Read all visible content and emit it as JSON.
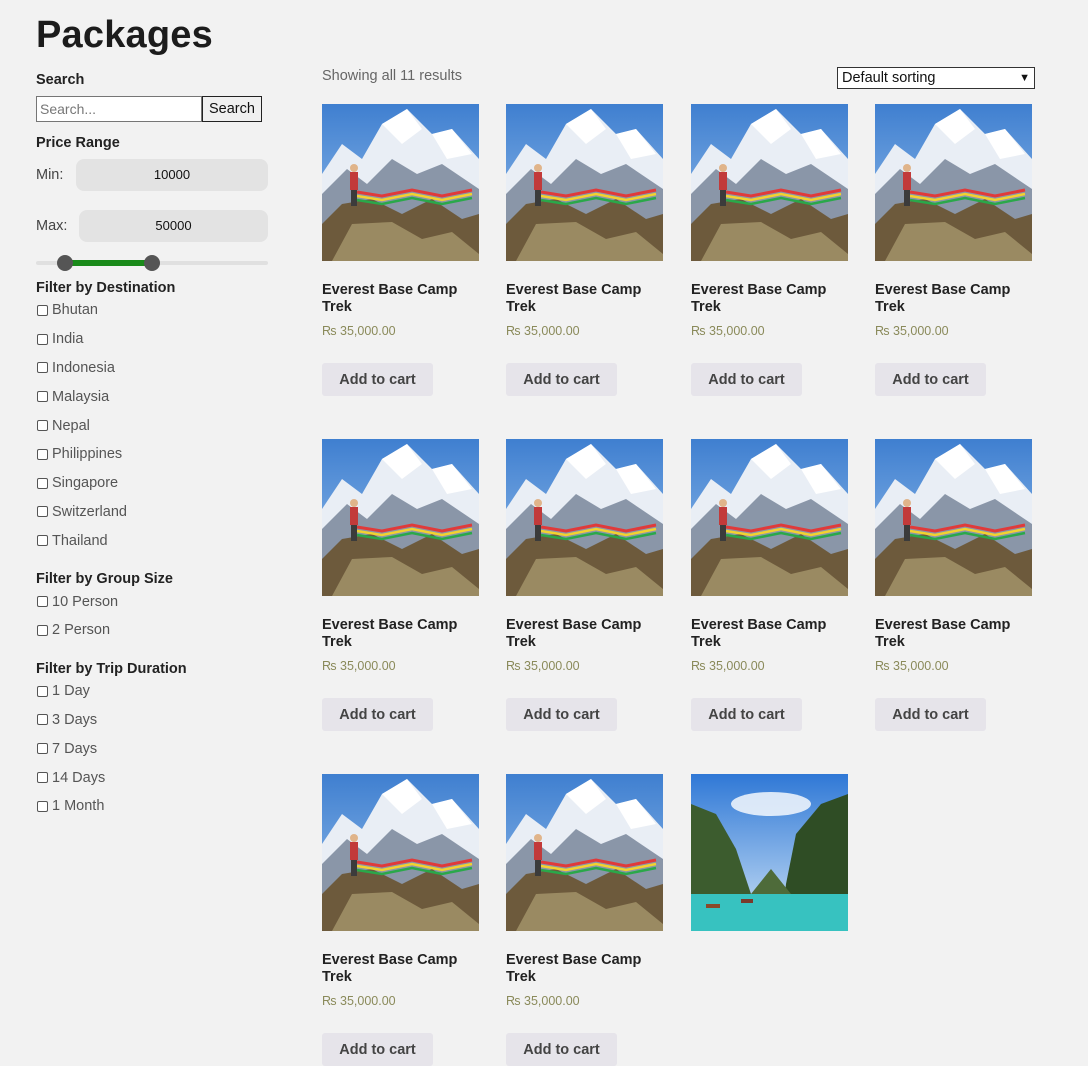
{
  "page": {
    "title": "Packages"
  },
  "sidebar": {
    "search": {
      "heading": "Search",
      "placeholder": "Search...",
      "button_label": "Search"
    },
    "price_range": {
      "heading": "Price Range",
      "min_label": "Min:",
      "min_value": "10000",
      "max_label": "Max:",
      "max_value": "50000",
      "slider_low_fraction": 0.12,
      "slider_high_fraction": 0.5
    },
    "destination": {
      "heading": "Filter by Destination",
      "options": [
        "Bhutan",
        "India",
        "Indonesia",
        "Malaysia",
        "Nepal",
        "Philippines",
        "Singapore",
        "Switzerland",
        "Thailand"
      ]
    },
    "group_size": {
      "heading": "Filter by Group Size",
      "options": [
        "10 Person",
        "2 Person"
      ]
    },
    "duration": {
      "heading": "Filter by Trip Duration",
      "options": [
        "1 Day",
        "3 Days",
        "7 Days",
        "14 Days",
        "1 Month"
      ]
    }
  },
  "main": {
    "results_count": "Showing all 11 results",
    "sort": {
      "selected": "Default sorting"
    },
    "products": [
      {
        "title": "Everest Base Camp Trek",
        "price": "₨ 35,000.00",
        "button": "Add to cart",
        "image": "mountain-photo"
      },
      {
        "title": "Everest Base Camp Trek",
        "price": "₨ 35,000.00",
        "button": "Add to cart",
        "image": "mountain-photo"
      },
      {
        "title": "Everest Base Camp Trek",
        "price": "₨ 35,000.00",
        "button": "Add to cart",
        "image": "mountain-photo"
      },
      {
        "title": "Everest Base Camp Trek",
        "price": "₨ 35,000.00",
        "button": "Add to cart",
        "image": "mountain-photo"
      },
      {
        "title": "Everest Base Camp Trek",
        "price": "₨ 35,000.00",
        "button": "Add to cart",
        "image": "mountain-photo"
      },
      {
        "title": "Everest Base Camp Trek",
        "price": "₨ 35,000.00",
        "button": "Add to cart",
        "image": "mountain-photo"
      },
      {
        "title": "Everest Base Camp Trek",
        "price": "₨ 35,000.00",
        "button": "Add to cart",
        "image": "mountain-photo"
      },
      {
        "title": "Everest Base Camp Trek",
        "price": "₨ 35,000.00",
        "button": "Add to cart",
        "image": "mountain-photo"
      },
      {
        "title": "Everest Base Camp Trek",
        "price": "₨ 35,000.00",
        "button": "Add to cart",
        "image": "mountain-photo"
      },
      {
        "title": "Everest Base Camp Trek",
        "price": "₨ 35,000.00",
        "button": "Add to cart",
        "image": "mountain-photo"
      },
      {
        "image": "bay-photo"
      }
    ]
  },
  "colors": {
    "slider_fill": "#1a8a1a",
    "slider_handle": "#555555",
    "background": "#f2f2f2",
    "price": "#8a8a5a"
  }
}
